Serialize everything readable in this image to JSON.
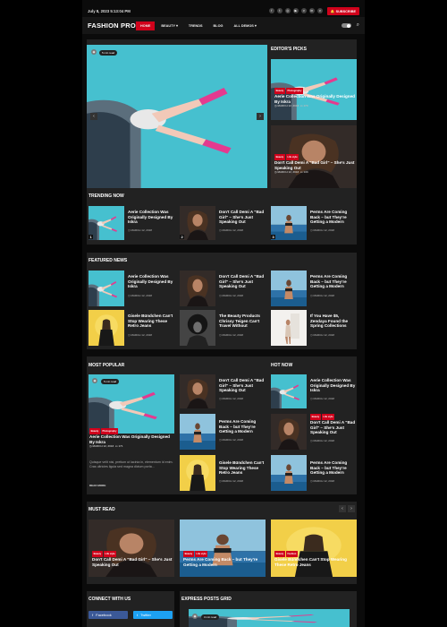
{
  "topbar": {
    "date": "July 8, 2023 5:13:04 PM",
    "subscribe": "SUBSCRIBE",
    "social_icons": [
      "facebook-icon",
      "twitter-icon",
      "instagram-icon",
      "youtube-icon",
      "vk-icon",
      "linkedin-icon",
      "vimeo-icon"
    ]
  },
  "header": {
    "logo": "FASHION PRO",
    "nav": [
      "HOME",
      "BEAUTY",
      "TRENDS",
      "BLOG",
      "ALL DEMOS"
    ]
  },
  "hero": {
    "badge": "5 min read",
    "post_meta_date": "MARCH 12, 2018"
  },
  "editors_picks": {
    "title": "EDITOR'S PICKS",
    "items": [
      {
        "tags": [
          "Beauty",
          "Photography"
        ],
        "title": "Aerie Collection Was Originally Designed By Iskra",
        "date": "MARCH 12, 2018",
        "comments": "170"
      },
      {
        "tags": [
          "Beauty",
          "Life style"
        ],
        "title": "Don't Call Demi A \"Bad Girl\" – She's Just Speaking Out",
        "date": "MARCH 12, 2018",
        "comments": "133"
      }
    ]
  },
  "trending": {
    "title": "TRENDING NOW",
    "items": [
      {
        "title": "Aerie Collection Was Originally Designed By Iskra",
        "date": "MARCH 12, 2018",
        "num": "1"
      },
      {
        "title": "Don't Call Demi A \"Bad Girl\" – She's Just Speaking Out",
        "date": "MARCH 12, 2018",
        "num": "2"
      },
      {
        "title": "Perms Are Coming Back – but They're Getting a Modern",
        "date": "MARCH 12, 2018",
        "num": "3"
      }
    ]
  },
  "featured": {
    "title": "FEATURED NEWS",
    "items": [
      {
        "title": "Aerie Collection Was Originally Designed By Iskra",
        "date": "MARCH 12, 2018"
      },
      {
        "title": "Don't Call Demi A \"Bad Girl\" – She's Just Speaking Out",
        "date": "MARCH 12, 2018"
      },
      {
        "title": "Perms Are Coming Back – but They're Getting a Modern",
        "date": "MARCH 12, 2018"
      },
      {
        "title": "Gisele Bündchen Can't Stop Wearing These Retro Jeans",
        "date": "MARCH 12, 2018"
      },
      {
        "title": "The Beauty Products Chrissy Teigen Can't Travel Without",
        "date": "MARCH 12, 2018"
      },
      {
        "title": "If You Have $5, Zendaya Found the Spring Collections",
        "date": "MARCH 12, 2018"
      }
    ]
  },
  "popular": {
    "title": "MOST POPULAR",
    "badge": "5 min read",
    "main": {
      "tags": [
        "Beauty",
        "Photography"
      ],
      "title": "Aerie Collection Was Originally Designed By Iskra",
      "date": "MARCH 12, 2018",
      "comments": "171",
      "excerpt": "Quisque velit nisi, pretium ut lacinia in, elementum id enim. Cras ultricies ligula sed magna dictum porta...",
      "read_more": "READ MORE"
    },
    "items": [
      {
        "title": "Don't Call Demi A \"Bad Girl\" – She's Just Speaking Out",
        "date": "MARCH 12, 2018"
      },
      {
        "title": "Perms Are Coming Back – but They're Getting a Modern",
        "date": "MARCH 12, 2018"
      },
      {
        "title": "Gisele Bündchen Can't Stop Wearing These Retro Jeans",
        "date": "MARCH 12, 2018"
      }
    ]
  },
  "hot": {
    "title": "HOT NOW",
    "items": [
      {
        "title": "Aerie Collection Was Originally Designed By Iskra",
        "date": "MARCH 12, 2018",
        "tags": []
      },
      {
        "title": "Don't Call Demi A \"Bad Girl\" – She's Just Speaking Out",
        "date": "MARCH 12, 2018",
        "tags": [
          "Beauty",
          "Life style"
        ]
      },
      {
        "title": "Perms Are Coming Back – but They're Getting a Modern",
        "date": "MARCH 12, 2018",
        "tags": []
      }
    ]
  },
  "mustread": {
    "title": "MUST READ",
    "items": [
      {
        "tags": [
          "Beauty",
          "Life style"
        ],
        "title": "Don't Call Demi A \"Bad Girl\" – She's Just Speaking Out",
        "date": "MARCH 12, 2018"
      },
      {
        "tags": [
          "Beauty",
          "Life style"
        ],
        "title": "Perms Are Coming Back – but They're Getting a Modern",
        "date": "MARCH 12, 2018"
      },
      {
        "tags": [
          "Beauty",
          "Fashion"
        ],
        "title": "Gisele Bündchen Can't Stop Wearing These Retro Jeans",
        "date": "MARCH 12, 2018"
      }
    ]
  },
  "connect": {
    "title": "CONNECT WITH US",
    "facebook": "Facebook",
    "twitter": "Twitter"
  },
  "express": {
    "title": "EXPRESS POSTS GRID",
    "badge": "3 min read"
  },
  "colors": {
    "accent": "#d0021b",
    "panel": "#222222",
    "bg": "#000000"
  }
}
